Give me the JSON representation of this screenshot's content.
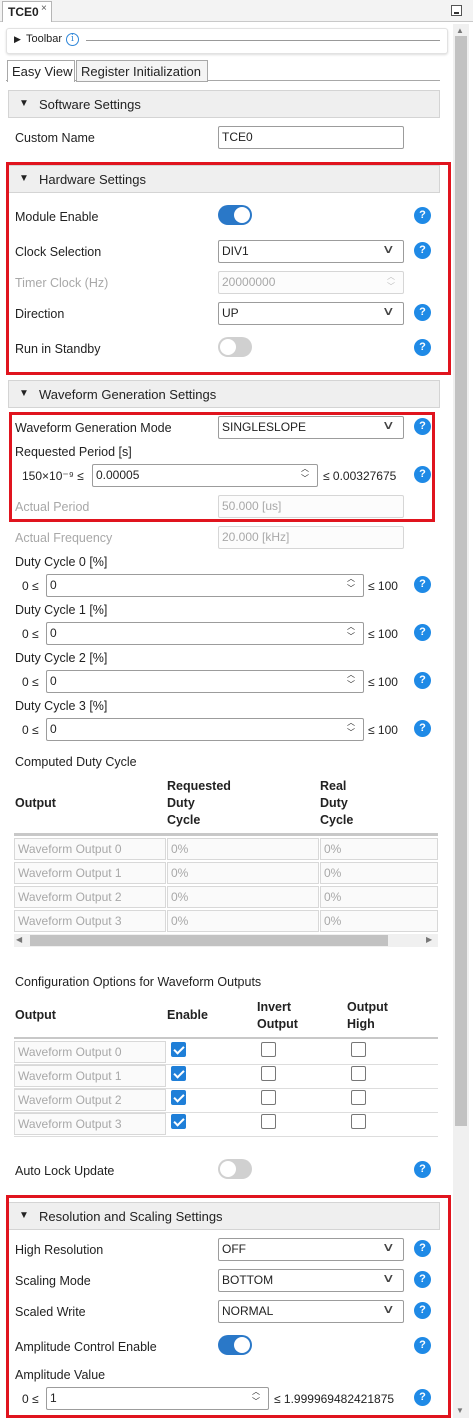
{
  "window": {
    "tab_title": "TCE0",
    "close_glyph": "×"
  },
  "toolbar": {
    "label": "Toolbar",
    "info_glyph": "i"
  },
  "tabs": [
    "Easy View",
    "Register Initialization"
  ],
  "software": {
    "title": "Software Settings",
    "custom_name_label": "Custom Name",
    "custom_name_value": "TCE0"
  },
  "hardware": {
    "title": "Hardware Settings",
    "module_enable_label": "Module Enable",
    "module_enable": true,
    "clock_selection_label": "Clock Selection",
    "clock_selection_value": "DIV1",
    "timer_clock_label": "Timer Clock (Hz)",
    "timer_clock_value": "20000000",
    "direction_label": "Direction",
    "direction_value": "UP",
    "run_in_standby_label": "Run in Standby",
    "run_in_standby": false
  },
  "waveform": {
    "title": "Waveform Generation Settings",
    "mode_label": "Waveform Generation Mode",
    "mode_value": "SINGLESLOPE",
    "requested_period_label": "Requested Period [s]",
    "requested_period_min": "150×10⁻⁹ ≤",
    "requested_period_value": "0.00005",
    "requested_period_max": "≤ 0.00327675",
    "actual_period_label": "Actual Period",
    "actual_period_value": "50.000 [us]",
    "actual_frequency_label": "Actual Frequency",
    "actual_frequency_value": "20.000 [kHz]",
    "duty_cycles": [
      {
        "label": "Duty Cycle 0 [%]",
        "min": "0 ≤",
        "value": "0",
        "max": "≤ 100"
      },
      {
        "label": "Duty Cycle 1 [%]",
        "min": "0 ≤",
        "value": "0",
        "max": "≤ 100"
      },
      {
        "label": "Duty Cycle 2 [%]",
        "min": "0 ≤",
        "value": "0",
        "max": "≤ 100"
      },
      {
        "label": "Duty Cycle 3 [%]",
        "min": "0 ≤",
        "value": "0",
        "max": "≤ 100"
      }
    ],
    "computed_title": "Computed Duty Cycle",
    "computed_headers": [
      "Output",
      "Requested\nDuty\nCycle",
      "Real\nDuty\nCycle"
    ],
    "computed_rows": [
      [
        "Waveform Output 0",
        "0%",
        "0%"
      ],
      [
        "Waveform Output 1",
        "0%",
        "0%"
      ],
      [
        "Waveform Output 2",
        "0%",
        "0%"
      ],
      [
        "Waveform Output 3",
        "0%",
        "0%"
      ]
    ],
    "config_title": "Configuration Options for Waveform Outputs",
    "config_headers": [
      "Output",
      "Enable",
      "Invert\nOutput",
      "Output\nHigh"
    ],
    "config_rows": [
      {
        "name": "Waveform Output 0",
        "enable": true,
        "invert": false,
        "high": false
      },
      {
        "name": "Waveform Output 1",
        "enable": true,
        "invert": false,
        "high": false
      },
      {
        "name": "Waveform Output 2",
        "enable": true,
        "invert": false,
        "high": false
      },
      {
        "name": "Waveform Output 3",
        "enable": true,
        "invert": false,
        "high": false
      }
    ],
    "auto_lock_label": "Auto Lock Update",
    "auto_lock": false
  },
  "resolution": {
    "title": "Resolution and Scaling Settings",
    "high_resolution_label": "High Resolution",
    "high_resolution_value": "OFF",
    "scaling_mode_label": "Scaling Mode",
    "scaling_mode_value": "BOTTOM",
    "scaled_write_label": "Scaled Write",
    "scaled_write_value": "NORMAL",
    "amplitude_control_label": "Amplitude Control Enable",
    "amplitude_control": true,
    "amplitude_value_label": "Amplitude Value",
    "amplitude_min": "0 ≤",
    "amplitude_value": "1",
    "amplitude_max": "≤ 1.999969482421875"
  },
  "glyphs": {
    "help": "?",
    "section_expanded": "▼",
    "toolbar_collapsed": "▶",
    "dropdown": "∨",
    "spin_up": "︿",
    "spin_down": "﹀",
    "scroll_left": "◀",
    "scroll_right": "▶",
    "scroll_up": "▲",
    "scroll_down": "▼"
  },
  "colors": {
    "accent": "#1f8ae6",
    "toggle_on": "#2a78c8",
    "highlight_border": "#e0141e"
  }
}
